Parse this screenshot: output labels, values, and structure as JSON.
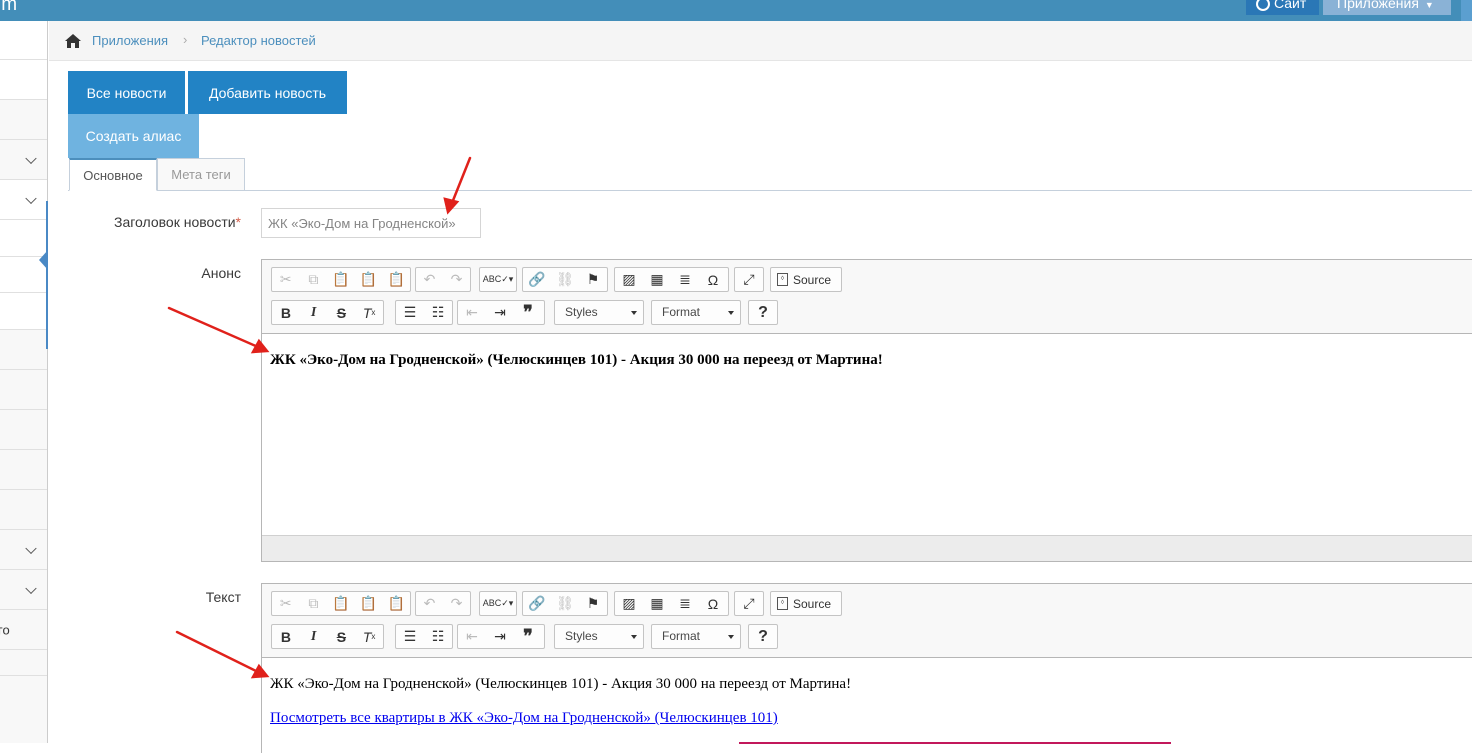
{
  "topbar": {
    "brand_fragment": "ım",
    "site_button": "Сайт",
    "apps_button": "Приложения"
  },
  "sidebar": {
    "partial_item_text": "го"
  },
  "breadcrumb": {
    "items": [
      "Приложения",
      "Редактор новостей"
    ],
    "separator": "›"
  },
  "actions": {
    "all_news": "Все новости",
    "add_news": "Добавить новость",
    "create_alias": "Создать алиас"
  },
  "tabs": {
    "main": "Основное",
    "meta": "Мета теги"
  },
  "form": {
    "title_label": "Заголовок новости",
    "required_mark": "*",
    "title_value": "ЖК «Эко-Дом на Гродненской»",
    "announce_label": "Анонс",
    "text_label": "Текст"
  },
  "editor_toolbar": {
    "source_label": "Source",
    "styles_label": "Styles",
    "format_label": "Format",
    "help_label": "?"
  },
  "announce_editor": {
    "content": "ЖК «Эко-Дом на Гродненской» (Челюскинцев 101) - Акция 30 000 на переезд от Мартина!"
  },
  "text_editor": {
    "paragraph": "ЖК «Эко-Дом на Гродненской» (Челюскинцев 101) - Акция 30 000 на переезд от Мартина!",
    "link": "Посмотреть все квартиры в ЖК «Эко-Дом на Гродненской» (Челюскинцев 101)"
  },
  "colors": {
    "topbar": "#438eb9",
    "primary_button": "#2283c5",
    "light_button": "#6fb3e0",
    "link": "#0000ee",
    "annotation_arrow": "#e0211b"
  }
}
